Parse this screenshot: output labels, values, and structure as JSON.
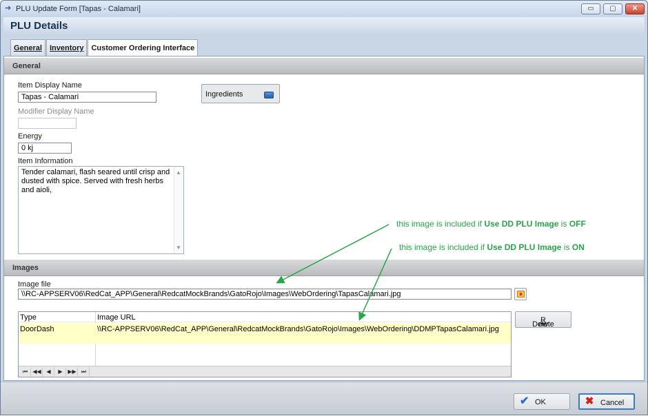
{
  "window": {
    "title": "PLU Update Form [Tapas - Calamari]",
    "buttons": {
      "minimize": "▭",
      "maximize": "▢",
      "close": "✕"
    }
  },
  "header": {
    "title": "PLU Details"
  },
  "tabs": [
    {
      "label": "General"
    },
    {
      "label": "Inventory"
    },
    {
      "label": "Customer Ordering Interface"
    }
  ],
  "general": {
    "section_title": "General",
    "item_display_name_label": "Item Display Name",
    "item_display_name_value": "Tapas - Calamari",
    "modifier_display_name_label": "Modifier Display Name",
    "modifier_display_name_value": "",
    "energy_label": "Energy",
    "energy_value": "0 kj",
    "item_information_label": "Item Information",
    "item_information_value": "Tender calamari, flash seared until crisp and dusted with spice. Served with fresh herbs and aioli,",
    "ingredients_button": "Ingredients"
  },
  "images": {
    "section_title": "Images",
    "image_file_label": "Image file",
    "image_file_value": "\\\\RC-APPSERV06\\RedCat_APP\\General\\RedcatMockBrands\\GatoRojo\\Images\\WebOrdering\\TapasCalamari.jpg",
    "grid": {
      "columns": [
        "Type",
        "Image URL"
      ],
      "rows": [
        {
          "type": "DoorDash",
          "url": "\\\\RC-APPSERV06\\RedCat_APP\\General\\RedcatMockBrands\\GatoRojo\\Images\\WebOrdering\\DDMPTapasCalamari.jpg"
        }
      ],
      "nav": [
        "⏮",
        "◀◀",
        "◀",
        "▶",
        "▶▶",
        "⏭"
      ]
    },
    "delete_row_button": {
      "pre": "Delete ",
      "accel": "R",
      "post": "ow"
    }
  },
  "annotations": {
    "off": {
      "a": "this image is included if ",
      "b": "Use DD PLU Image",
      "c": " is ",
      "d": "OFF"
    },
    "on": {
      "a": "this image is included if ",
      "b": "Use DD PLU Image",
      "c": " is ",
      "d": "ON"
    },
    "color": "#2aa44a"
  },
  "footer": {
    "ok_label": "OK",
    "cancel_label": "Cancel"
  }
}
